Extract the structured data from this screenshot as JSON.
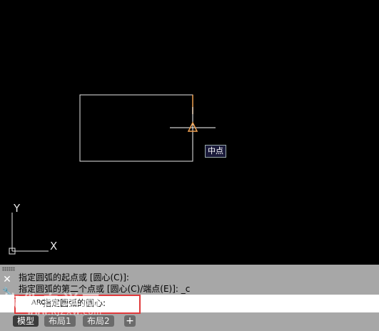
{
  "drawing": {
    "osnap_tooltip": "中点",
    "ucs_y_label": "Y",
    "ucs_x_label": "X"
  },
  "command": {
    "history": [
      "指定圆弧的起点或 [圆心(C)]:",
      "指定圆弧的第二个点或 [圆心(C)/端点(E)]: _c"
    ],
    "prompt": "指定圆弧的圆心:",
    "icon": "arc-command-icon"
  },
  "tabs": [
    {
      "label": "模型"
    },
    {
      "label": "布局1"
    },
    {
      "label": "布局2"
    }
  ],
  "watermark": {
    "main": "软件自学网",
    "url": "www.RJZXW.com"
  },
  "colors": {
    "canvas": "#000000",
    "lines": "#ffffff",
    "snap_marker": "#f0a050",
    "highlight": "#e0393b",
    "panel": "#a7a7a7"
  }
}
